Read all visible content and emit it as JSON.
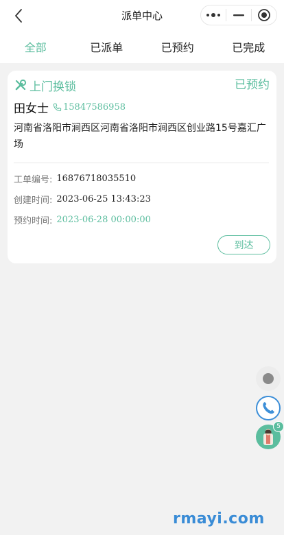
{
  "header": {
    "title": "派单中心",
    "back_icon": "chevron-left-icon",
    "more_icon": "more-dots-icon",
    "minimize_icon": "minimize-icon",
    "close_icon": "target-circle-icon"
  },
  "tabs": [
    {
      "label": "全部",
      "active": true
    },
    {
      "label": "已派单",
      "active": false
    },
    {
      "label": "已预约",
      "active": false
    },
    {
      "label": "已完成",
      "active": false
    }
  ],
  "order": {
    "service_type": "上门换锁",
    "service_icon": "wrench-icon",
    "status": "已预约",
    "customer_name": "田女士",
    "phone_icon": "phone-icon",
    "phone": "15847586958",
    "address": "河南省洛阳市涧西区河南省洛阳市涧西区创业路15号嘉汇广场",
    "order_no_label": "工单编号:",
    "order_no": "16876718035510",
    "created_label": "创建时间:",
    "created_time": "2023-06-25 13:43:23",
    "appointment_label": "预约时间:",
    "appointment_time": "2023-06-28 00:00:00",
    "action_label": "到达"
  },
  "floating": {
    "record_icon": "record-dot-icon",
    "phone_icon": "phone-call-icon",
    "avatar_icon": "service-avatar-icon",
    "badge_count": "5"
  },
  "watermark": "rmayi.com",
  "colors": {
    "accent": "#5bbd9e",
    "background": "#f2f2f2",
    "watermark": "#3a8cd6",
    "phone_ring": "#3d8fd8"
  }
}
